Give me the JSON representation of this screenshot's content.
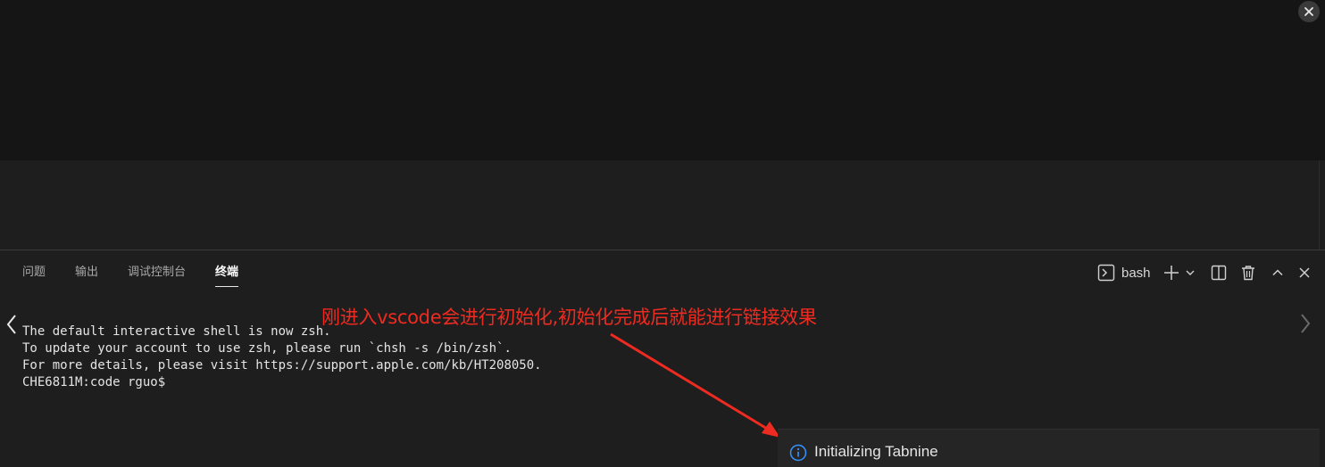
{
  "panel": {
    "tabs": [
      {
        "label": "问题"
      },
      {
        "label": "输出"
      },
      {
        "label": "调试控制台"
      },
      {
        "label": "终端"
      }
    ],
    "active_tab": 3,
    "terminal_profile": "bash"
  },
  "terminal": {
    "lines": [
      "The default interactive shell is now zsh.",
      "To update your account to use zsh, please run `chsh -s /bin/zsh`.",
      "For more details, please visit https://support.apple.com/kb/HT208050.",
      "CHE6811M:code rguo$"
    ]
  },
  "annotation": {
    "text": "刚进入vscode会进行初始化,初始化完成后就能进行链接效果",
    "color": "#ee2b20"
  },
  "notification": {
    "icon": "info-icon",
    "message": "Initializing Tabnine",
    "accent": "#3794ff"
  }
}
